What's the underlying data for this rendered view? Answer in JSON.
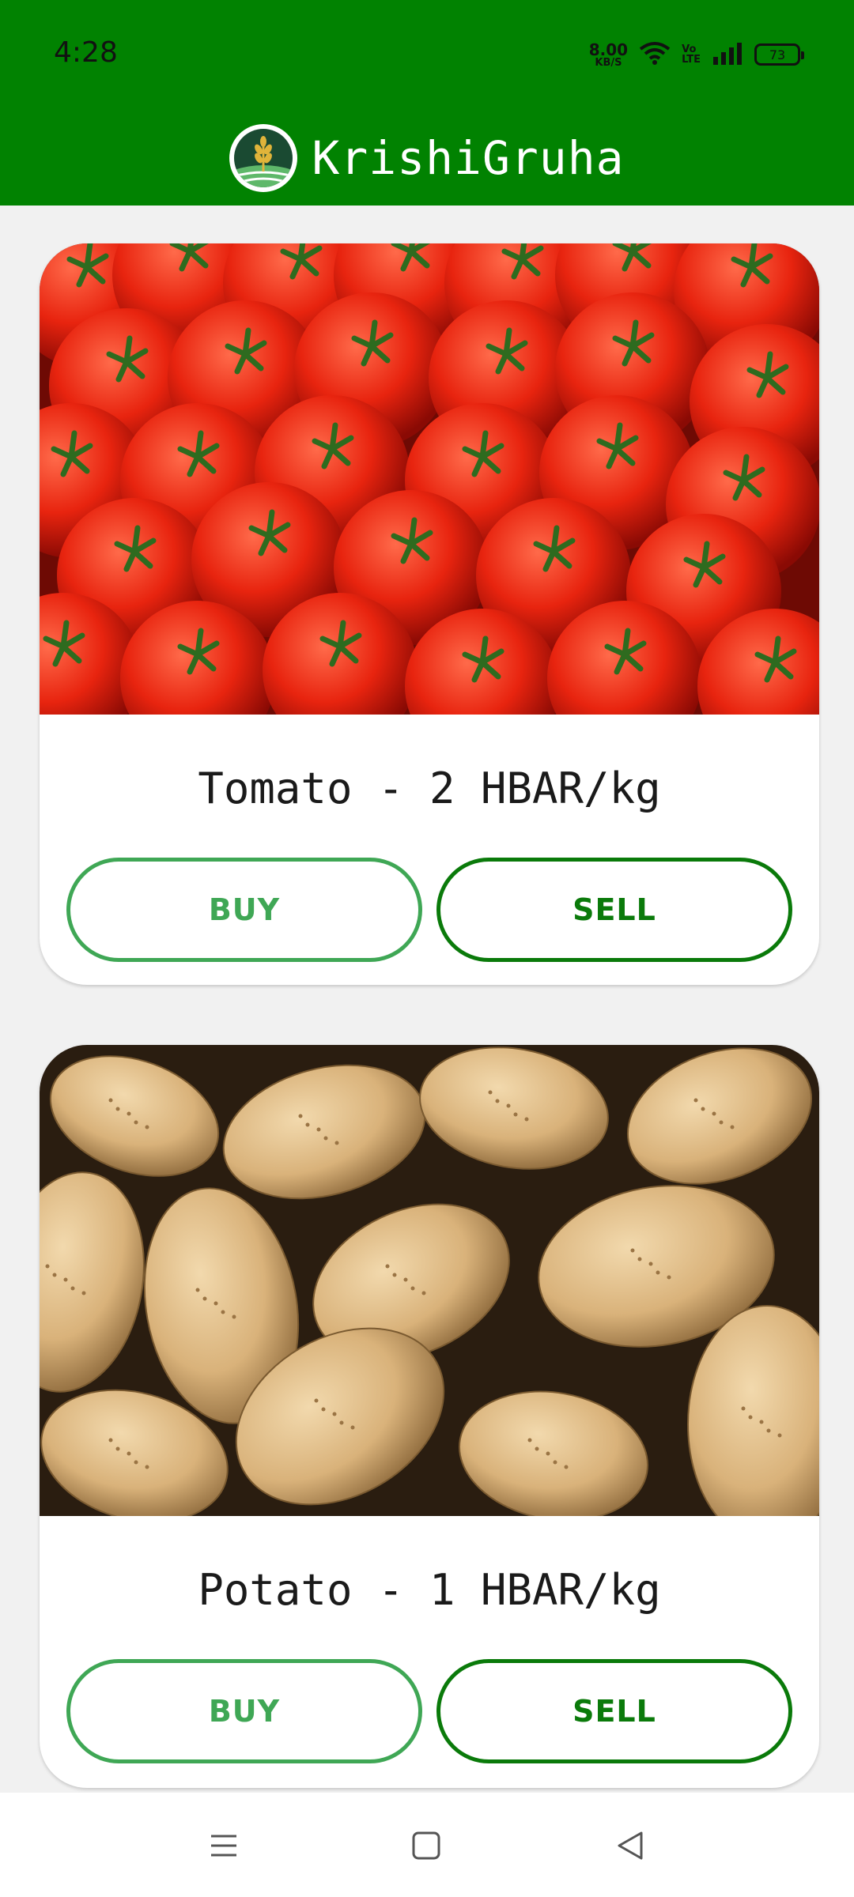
{
  "status_bar": {
    "time": "4:28",
    "net_speed_value": "8.00",
    "net_speed_unit": "KB/S",
    "volte_top": "Vo",
    "volte_bottom": "LTE",
    "battery": "73"
  },
  "app_bar": {
    "title": "KrishiGruha",
    "logo_icon": "wheat-logo-icon",
    "background": "#018201"
  },
  "products": [
    {
      "title": "Tomato - 2 HBAR/kg",
      "image": "tomato-image",
      "buy_label": "BUY",
      "sell_label": "SELL"
    },
    {
      "title": "Potato - 1 HBAR/kg",
      "image": "potato-image",
      "buy_label": "BUY",
      "sell_label": "SELL"
    }
  ],
  "colors": {
    "primary": "#018201",
    "buy_outline": "#3fa755",
    "sell_outline": "#0a7a0a"
  },
  "nav_bar": {
    "icons": [
      "menu-icon",
      "home-square-icon",
      "back-triangle-icon"
    ]
  }
}
